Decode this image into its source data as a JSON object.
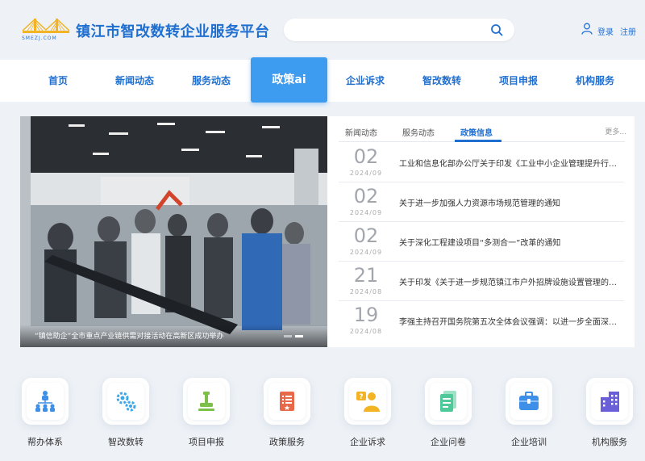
{
  "header": {
    "logo_text": "SMEZJ.COM",
    "site_title": "镇江市智改数转企业服务平台",
    "search_placeholder": "",
    "login_label": "登录",
    "register_label": "注册"
  },
  "nav": {
    "items": [
      "首页",
      "新闻动态",
      "服务动态",
      "政策ai",
      "企业诉求",
      "智改数转",
      "项目申报",
      "机构服务"
    ],
    "active_index": 3
  },
  "banner": {
    "caption": "“镇信助企”全市重点产业链供需对接活动在高新区成功举办",
    "slide_count": 2,
    "active_slide": 1
  },
  "news_panel": {
    "tabs": [
      "新闻动态",
      "服务动态",
      "政策信息"
    ],
    "active_tab": 2,
    "more_label": "更多...",
    "items": [
      {
        "day": "02",
        "date": "2024/09",
        "title": "工业和信息化部办公厅关于印发《工业中小企业管理提升行动方案》的通知"
      },
      {
        "day": "02",
        "date": "2024/09",
        "title": "关于进一步加强人力资源市场规范管理的通知"
      },
      {
        "day": "02",
        "date": "2024/09",
        "title": "关于深化工程建设项目“多测合一”改革的通知"
      },
      {
        "day": "21",
        "date": "2024/08",
        "title": "关于印发《关于进一步规范镇江市户外招牌设施设置管理的实施意见》的通知"
      },
      {
        "day": "19",
        "date": "2024/08",
        "title": "李强主持召开国务院第五次全体会议强调：以进一步全面深化改革推动高质量发展"
      }
    ]
  },
  "services": [
    {
      "label": "帮办体系",
      "icon": "org-chart-icon",
      "color": "#3d8fe8"
    },
    {
      "label": "智改数转",
      "icon": "gears-icon",
      "color": "#3da7e8"
    },
    {
      "label": "项目申报",
      "icon": "stamp-icon",
      "color": "#7cc04a"
    },
    {
      "label": "政策服务",
      "icon": "document-icon",
      "color": "#e8684a"
    },
    {
      "label": "企业诉求",
      "icon": "question-person-icon",
      "color": "#f2b324"
    },
    {
      "label": "企业问卷",
      "icon": "questionnaire-icon",
      "color": "#4fc99a"
    },
    {
      "label": "企业培训",
      "icon": "briefcase-icon",
      "color": "#3d8fe8"
    },
    {
      "label": "机构服务",
      "icon": "building-icon",
      "color": "#6a5fd8"
    }
  ]
}
